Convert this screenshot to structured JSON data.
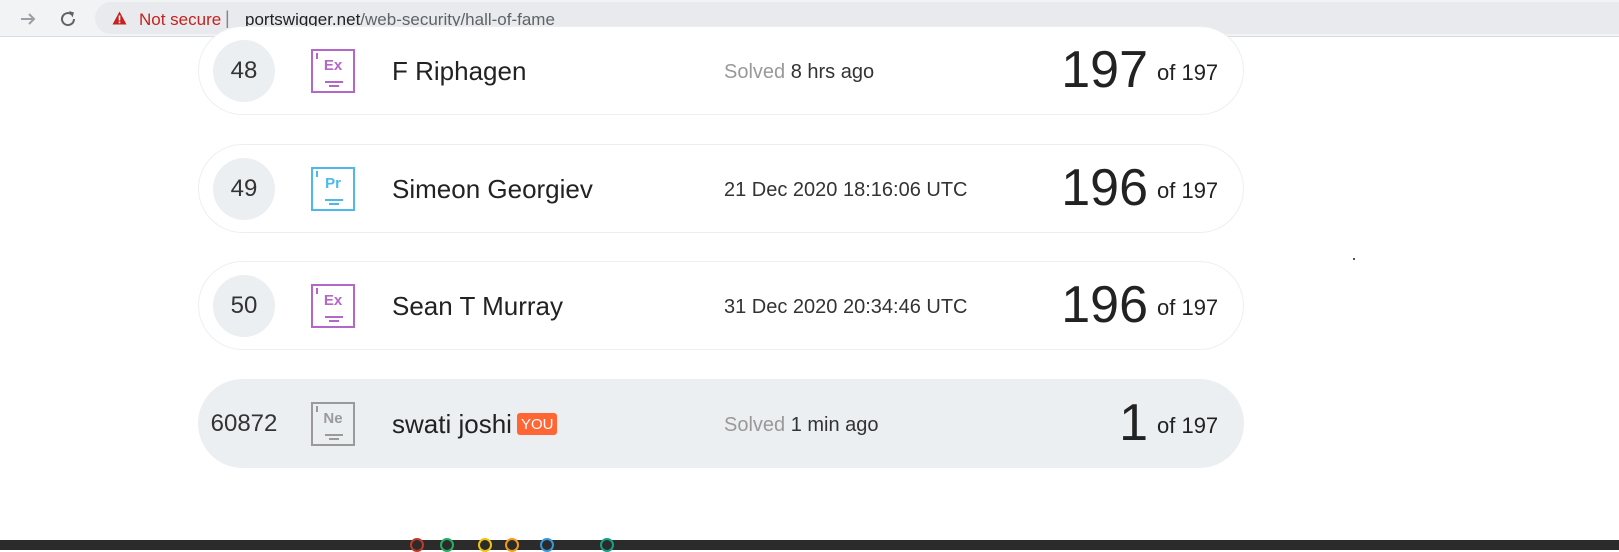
{
  "browser": {
    "security_label": "Not secure",
    "url_host": "portswigger.net",
    "url_path": "/web-security/hall-of-fame"
  },
  "colors": {
    "expert": "#b566c9",
    "practitioner": "#4db8ea",
    "newcomer": "#9a9a9a",
    "you_tag": "#ff6633",
    "warning": "#c5221f"
  },
  "rows": [
    {
      "rank": "48",
      "level": "expert",
      "badge_symbol": "Ex",
      "name": "F Riphagen",
      "solved_label": "Solved",
      "solved_value": "8 hrs ago",
      "score": "197",
      "of_total": "of 197"
    },
    {
      "rank": "49",
      "level": "practitioner",
      "badge_symbol": "Pr",
      "name": "Simeon Georgiev",
      "solved_label": "",
      "solved_value": "21 Dec 2020 18:16:06 UTC",
      "score": "196",
      "of_total": "of 197"
    },
    {
      "rank": "50",
      "level": "expert",
      "badge_symbol": "Ex",
      "name": "Sean T Murray",
      "solved_label": "",
      "solved_value": "31 Dec 2020 20:34:46 UTC",
      "score": "196",
      "of_total": "of 197"
    },
    {
      "rank": "60872",
      "level": "newcomer",
      "badge_symbol": "Ne",
      "name": "swati joshi",
      "you_tag": "YOU",
      "solved_label": "Solved",
      "solved_value": "1 min ago",
      "score": "1",
      "of_total": "of 197"
    }
  ]
}
